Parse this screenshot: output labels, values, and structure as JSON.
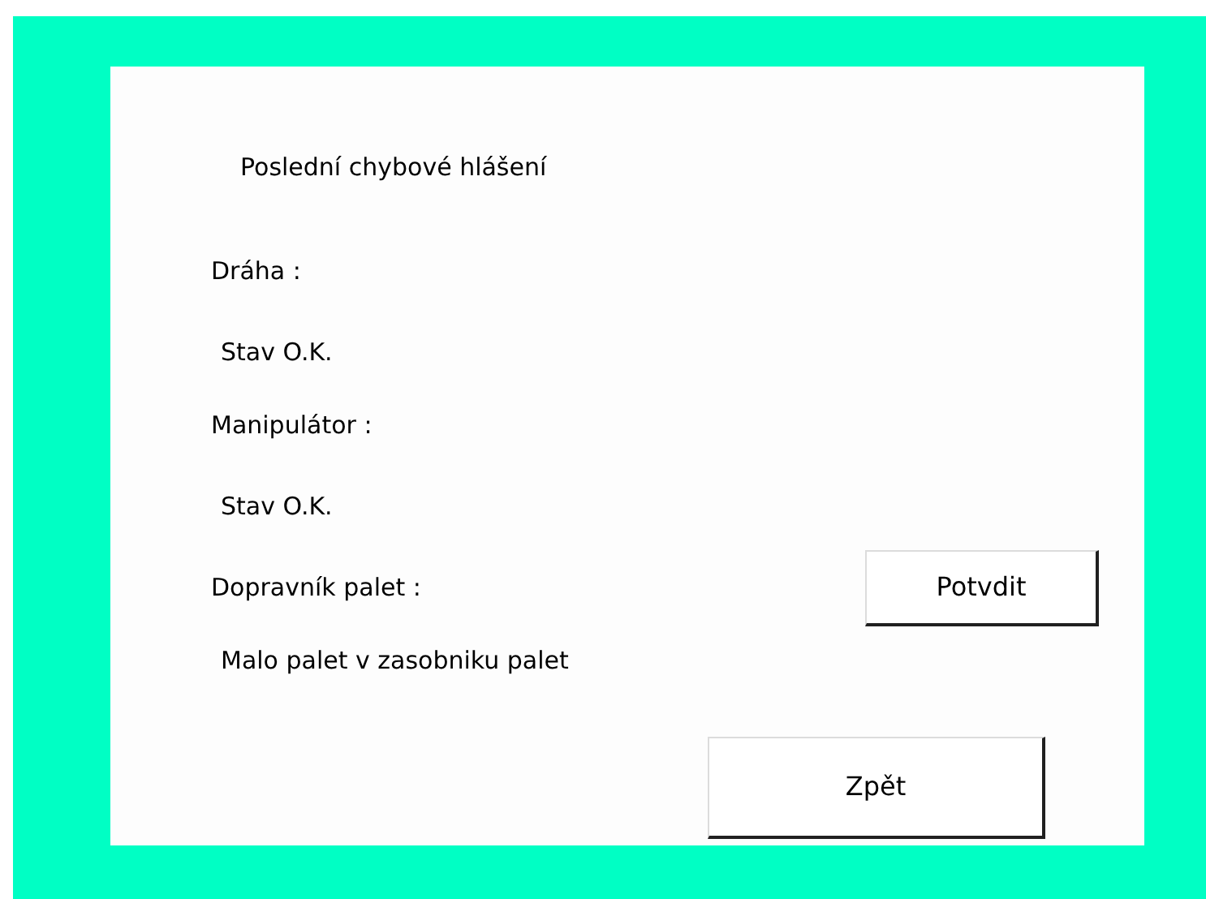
{
  "title": "Poslední chybové hlášení",
  "sections": [
    {
      "label": "Dráha :",
      "status": "Stav O.K."
    },
    {
      "label": "Manipulátor :",
      "status": "Stav O.K."
    },
    {
      "label": "Dopravník palet :",
      "status": "Malo palet v zasobniku palet"
    }
  ],
  "confirm_button": "Potvdit",
  "back_button": "Zpět"
}
